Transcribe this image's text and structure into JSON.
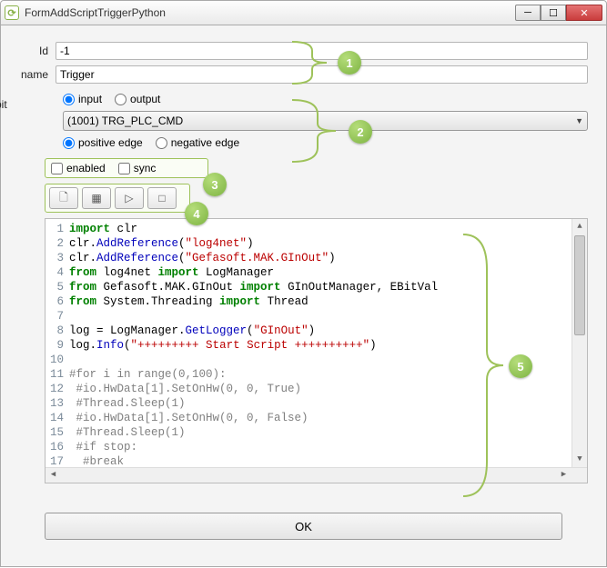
{
  "window": {
    "title": "FormAddScriptTriggerPython"
  },
  "fields": {
    "id_label": "Id",
    "id_value": "-1",
    "name_label": "name",
    "name_value": "Trigger"
  },
  "io": {
    "input_label": "input",
    "output_label": "output",
    "input_checked": true,
    "output_checked": false
  },
  "bit": {
    "label": "bit",
    "selected": "(1001) TRG_PLC_CMD"
  },
  "edge": {
    "positive_label": "positive edge",
    "negative_label": "negative edge",
    "positive_checked": true,
    "negative_checked": false
  },
  "flags": {
    "enabled_label": "enabled",
    "sync_label": "sync",
    "enabled_checked": false,
    "sync_checked": false
  },
  "toolbar_icons": {
    "new": "🗋",
    "debug": "▦",
    "run": "▷",
    "stop": "□"
  },
  "code_lines": [
    {
      "n": 1,
      "html": "<span class='kw'>import</span> clr"
    },
    {
      "n": 2,
      "html": "clr.<span class='fn'>AddReference</span>(<span class='str'>\"log4net\"</span>)"
    },
    {
      "n": 3,
      "html": "clr.<span class='fn'>AddReference</span>(<span class='str'>\"Gefasoft.MAK.GInOut\"</span>)"
    },
    {
      "n": 4,
      "html": "<span class='kw'>from</span> log4net <span class='kw'>import</span> LogManager"
    },
    {
      "n": 5,
      "html": "<span class='kw'>from</span> Gefasoft.MAK.GInOut <span class='kw'>import</span> GInOutManager, EBitVal"
    },
    {
      "n": 6,
      "html": "<span class='kw'>from</span> System.Threading <span class='kw'>import</span> Thread"
    },
    {
      "n": 7,
      "html": ""
    },
    {
      "n": 8,
      "html": "log = LogManager.<span class='fn'>GetLogger</span>(<span class='str'>\"GInOut\"</span>)"
    },
    {
      "n": 9,
      "html": "log.<span class='fn'>Info</span>(<span class='str'>\"+++++++++ Start Script ++++++++++\"</span>)"
    },
    {
      "n": 10,
      "html": ""
    },
    {
      "n": 11,
      "html": "<span class='cmt'>#for i in range(0,100):</span>"
    },
    {
      "n": 12,
      "html": " <span class='cmt'>#io.HwData[1].SetOnHw(0, 0, True)</span>"
    },
    {
      "n": 13,
      "html": " <span class='cmt'>#Thread.Sleep(1)</span>"
    },
    {
      "n": 14,
      "html": " <span class='cmt'>#io.HwData[1].SetOnHw(0, 0, False)</span>"
    },
    {
      "n": 15,
      "html": " <span class='cmt'>#Thread.Sleep(1)</span>"
    },
    {
      "n": 16,
      "html": " <span class='cmt'>#if stop:</span>"
    },
    {
      "n": 17,
      "html": "  <span class='cmt'>#break</span>"
    }
  ],
  "ok_button": "OK",
  "callouts": [
    "1",
    "2",
    "3",
    "4",
    "5"
  ]
}
